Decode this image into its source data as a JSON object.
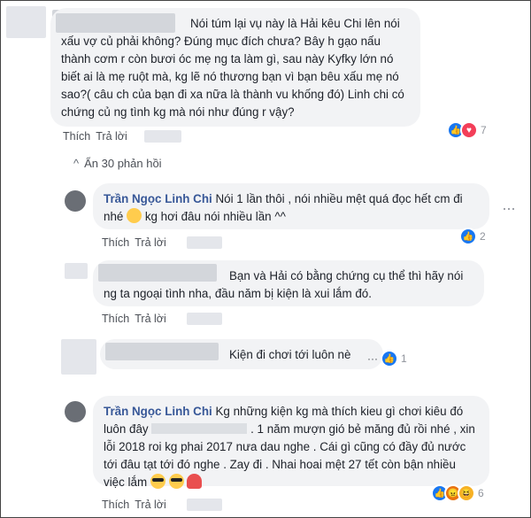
{
  "comments": [
    {
      "text": "Nói túm lại vụ này là Hải kêu Chi lên nói xấu vợ củ phải không? Đúng mục đích chưa? Bây h gạo nấu thành cơm r còn bươi óc mẹ ng ta làm gì, sau này Kyfky lớn nó biết ai là mẹ ruột mà, kg lẽ nó thương bạn vì bạn bêu xấu mẹ nó sao?( câu ch của bạn đi xa nữa là thành vu khống đó) Linh chi có chứng củ ng tình kg mà nói như đúng r vậy?",
      "like": "Thích",
      "reply": "Trả lời",
      "reaction_count": "7"
    },
    {
      "name": "Trần Ngọc Linh Chi",
      "text_1": "Nói 1 lần thôi , nói nhiều mệt quá đọc hết cm đi nhé",
      "text_2": "kg hơi đâu nói nhiều lần ^^",
      "like": "Thích",
      "reply": "Trả lời",
      "reaction_count": "2"
    },
    {
      "text": "Bạn và Hải có bằng chứng cụ thể thì hãy nói ng ta ngoại tình nha, đầu năm bị kiện là xui lắm đó.",
      "like": "Thích",
      "reply": "Trả lời"
    },
    {
      "text": "Kiện đi chơi tới luôn nè",
      "reaction_count": "1"
    },
    {
      "name": "Trần Ngọc Linh Chi",
      "text_1": "Kg những kiện kg mà thích kieu gì chơi kiêu đó luôn đây",
      "text_2": ". 1 năm mượn gió bẻ măng đủ rồi nhé , xin lỗi 2018 roi kg phai 2017 nưa dau nghe . Cái gì cũng có đầy đủ nước tới đâu tạt tới đó nghe . Zay đi . Nhai hoai mệt 27 tết còn bận nhiều việc lắm",
      "like": "Thích",
      "reply": "Trả lời",
      "reaction_count": "6"
    }
  ],
  "hide_replies": "Ẩn 30 phản hồi",
  "more_dots": "···"
}
